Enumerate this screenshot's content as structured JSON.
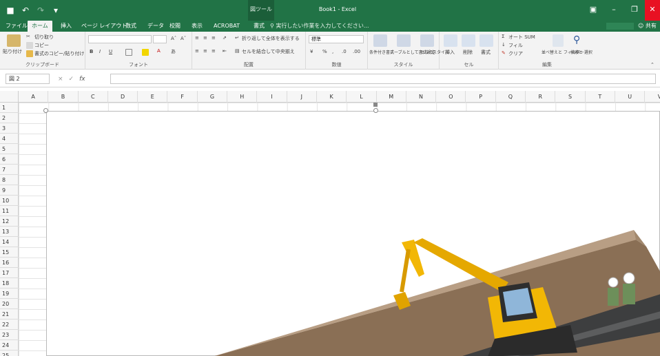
{
  "titlebar": {
    "context_tab": "図ツール",
    "title": "Book1 - Excel",
    "icons": [
      "save-icon",
      "undo-icon",
      "redo-icon",
      "customize-icon"
    ],
    "right_icons": [
      "ribbon-display-icon",
      "minimize-icon",
      "restore-icon",
      "close-icon"
    ]
  },
  "tabs": {
    "items": [
      "ファイル",
      "ホーム",
      "挿入",
      "ページ レイアウト",
      "数式",
      "データ",
      "校閲",
      "表示",
      "ACROBAT",
      "書式"
    ],
    "active": "ホーム",
    "tell_me": "実行したい作業を入力してください...",
    "share": "共有"
  },
  "ribbon": {
    "clipboard": {
      "paste": "貼り付け",
      "cut": "切り取り",
      "copy": "コピー",
      "format_painter": "書式のコピー/貼り付け",
      "label": "クリップボード"
    },
    "font": {
      "label": "フォント",
      "bold": "B",
      "italic": "I",
      "underline": "U"
    },
    "alignment": {
      "wrap": "折り返して全体を表示する",
      "merge": "セルを結合して中央揃え",
      "label": "配置"
    },
    "number": {
      "format": "標準",
      "label": "数値"
    },
    "styles": {
      "conditional": "条件付き書式",
      "table": "テーブルとして書式設定",
      "cell": "セルのスタイル",
      "label": "スタイル"
    },
    "cells": {
      "insert": "挿入",
      "delete": "削除",
      "format": "書式",
      "label": "セル"
    },
    "editing": {
      "autosum": "オート SUM",
      "fill": "フィル",
      "clear": "クリア",
      "sort": "並べ替えと フィルター",
      "find": "検索と 選択",
      "label": "編集"
    }
  },
  "formula_bar": {
    "name_box": "図 2",
    "cancel": "×",
    "enter": "✓",
    "fx": "fx",
    "value": ""
  },
  "grid": {
    "columns": [
      "A",
      "B",
      "C",
      "D",
      "E",
      "F",
      "G",
      "H",
      "I",
      "J",
      "K",
      "L",
      "M",
      "N",
      "O",
      "P",
      "Q",
      "R",
      "S",
      "T",
      "U",
      "V"
    ],
    "rows": [
      "1",
      "2",
      "3",
      "4",
      "5",
      "6",
      "7",
      "8",
      "9",
      "10",
      "11",
      "12",
      "13",
      "14",
      "15",
      "16",
      "17",
      "18",
      "19",
      "20",
      "21",
      "22",
      "23",
      "24",
      "25"
    ]
  },
  "colors": {
    "excel_green": "#217346",
    "close_red": "#e81123",
    "excavator_yellow": "#f2b705",
    "terrain_brown": "#8a6f55",
    "road_dark": "#3d3e3f"
  }
}
